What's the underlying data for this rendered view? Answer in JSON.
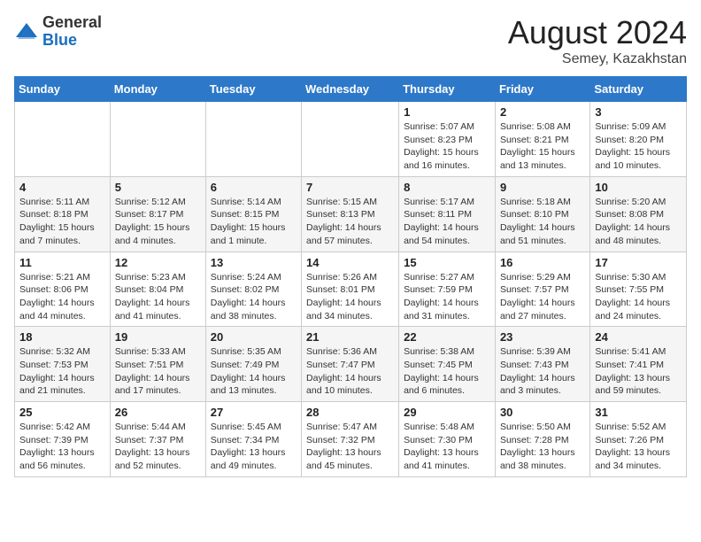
{
  "header": {
    "logo_general": "General",
    "logo_blue": "Blue",
    "title": "August 2024",
    "subtitle": "Semey, Kazakhstan"
  },
  "days_of_week": [
    "Sunday",
    "Monday",
    "Tuesday",
    "Wednesday",
    "Thursday",
    "Friday",
    "Saturday"
  ],
  "weeks": [
    [
      {
        "day": "",
        "info": ""
      },
      {
        "day": "",
        "info": ""
      },
      {
        "day": "",
        "info": ""
      },
      {
        "day": "",
        "info": ""
      },
      {
        "day": "1",
        "info": "Sunrise: 5:07 AM\nSunset: 8:23 PM\nDaylight: 15 hours and 16 minutes."
      },
      {
        "day": "2",
        "info": "Sunrise: 5:08 AM\nSunset: 8:21 PM\nDaylight: 15 hours and 13 minutes."
      },
      {
        "day": "3",
        "info": "Sunrise: 5:09 AM\nSunset: 8:20 PM\nDaylight: 15 hours and 10 minutes."
      }
    ],
    [
      {
        "day": "4",
        "info": "Sunrise: 5:11 AM\nSunset: 8:18 PM\nDaylight: 15 hours and 7 minutes."
      },
      {
        "day": "5",
        "info": "Sunrise: 5:12 AM\nSunset: 8:17 PM\nDaylight: 15 hours and 4 minutes."
      },
      {
        "day": "6",
        "info": "Sunrise: 5:14 AM\nSunset: 8:15 PM\nDaylight: 15 hours and 1 minute."
      },
      {
        "day": "7",
        "info": "Sunrise: 5:15 AM\nSunset: 8:13 PM\nDaylight: 14 hours and 57 minutes."
      },
      {
        "day": "8",
        "info": "Sunrise: 5:17 AM\nSunset: 8:11 PM\nDaylight: 14 hours and 54 minutes."
      },
      {
        "day": "9",
        "info": "Sunrise: 5:18 AM\nSunset: 8:10 PM\nDaylight: 14 hours and 51 minutes."
      },
      {
        "day": "10",
        "info": "Sunrise: 5:20 AM\nSunset: 8:08 PM\nDaylight: 14 hours and 48 minutes."
      }
    ],
    [
      {
        "day": "11",
        "info": "Sunrise: 5:21 AM\nSunset: 8:06 PM\nDaylight: 14 hours and 44 minutes."
      },
      {
        "day": "12",
        "info": "Sunrise: 5:23 AM\nSunset: 8:04 PM\nDaylight: 14 hours and 41 minutes."
      },
      {
        "day": "13",
        "info": "Sunrise: 5:24 AM\nSunset: 8:02 PM\nDaylight: 14 hours and 38 minutes."
      },
      {
        "day": "14",
        "info": "Sunrise: 5:26 AM\nSunset: 8:01 PM\nDaylight: 14 hours and 34 minutes."
      },
      {
        "day": "15",
        "info": "Sunrise: 5:27 AM\nSunset: 7:59 PM\nDaylight: 14 hours and 31 minutes."
      },
      {
        "day": "16",
        "info": "Sunrise: 5:29 AM\nSunset: 7:57 PM\nDaylight: 14 hours and 27 minutes."
      },
      {
        "day": "17",
        "info": "Sunrise: 5:30 AM\nSunset: 7:55 PM\nDaylight: 14 hours and 24 minutes."
      }
    ],
    [
      {
        "day": "18",
        "info": "Sunrise: 5:32 AM\nSunset: 7:53 PM\nDaylight: 14 hours and 21 minutes."
      },
      {
        "day": "19",
        "info": "Sunrise: 5:33 AM\nSunset: 7:51 PM\nDaylight: 14 hours and 17 minutes."
      },
      {
        "day": "20",
        "info": "Sunrise: 5:35 AM\nSunset: 7:49 PM\nDaylight: 14 hours and 13 minutes."
      },
      {
        "day": "21",
        "info": "Sunrise: 5:36 AM\nSunset: 7:47 PM\nDaylight: 14 hours and 10 minutes."
      },
      {
        "day": "22",
        "info": "Sunrise: 5:38 AM\nSunset: 7:45 PM\nDaylight: 14 hours and 6 minutes."
      },
      {
        "day": "23",
        "info": "Sunrise: 5:39 AM\nSunset: 7:43 PM\nDaylight: 14 hours and 3 minutes."
      },
      {
        "day": "24",
        "info": "Sunrise: 5:41 AM\nSunset: 7:41 PM\nDaylight: 13 hours and 59 minutes."
      }
    ],
    [
      {
        "day": "25",
        "info": "Sunrise: 5:42 AM\nSunset: 7:39 PM\nDaylight: 13 hours and 56 minutes."
      },
      {
        "day": "26",
        "info": "Sunrise: 5:44 AM\nSunset: 7:37 PM\nDaylight: 13 hours and 52 minutes."
      },
      {
        "day": "27",
        "info": "Sunrise: 5:45 AM\nSunset: 7:34 PM\nDaylight: 13 hours and 49 minutes."
      },
      {
        "day": "28",
        "info": "Sunrise: 5:47 AM\nSunset: 7:32 PM\nDaylight: 13 hours and 45 minutes."
      },
      {
        "day": "29",
        "info": "Sunrise: 5:48 AM\nSunset: 7:30 PM\nDaylight: 13 hours and 41 minutes."
      },
      {
        "day": "30",
        "info": "Sunrise: 5:50 AM\nSunset: 7:28 PM\nDaylight: 13 hours and 38 minutes."
      },
      {
        "day": "31",
        "info": "Sunrise: 5:52 AM\nSunset: 7:26 PM\nDaylight: 13 hours and 34 minutes."
      }
    ]
  ]
}
